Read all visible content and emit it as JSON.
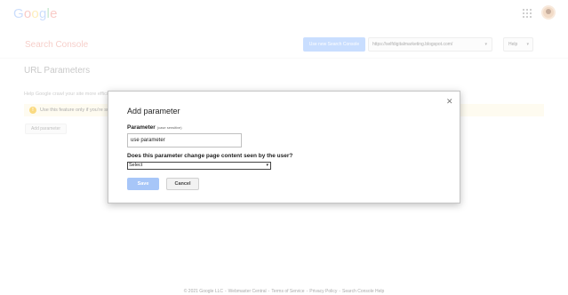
{
  "topbar": {
    "logo_letters": [
      {
        "ch": "G",
        "color": "#4285F4"
      },
      {
        "ch": "o",
        "color": "#EA4335"
      },
      {
        "ch": "o",
        "color": "#FBBC05"
      },
      {
        "ch": "g",
        "color": "#4285F4"
      },
      {
        "ch": "l",
        "color": "#34A853"
      },
      {
        "ch": "e",
        "color": "#EA4335"
      }
    ],
    "apps_icon": "apps-grid-icon",
    "avatar_icon": "user-avatar"
  },
  "header": {
    "product_title": "Search Console",
    "new_console_button": "Use new Search Console",
    "site_select_value": "https://selfdigitalmarketing.blogspot.com/",
    "help_label": "Help"
  },
  "page": {
    "title": "URL Parameters",
    "help_text": "Help Google crawl your site more efficiently",
    "warning_text": "Use this feature only if you're sure how parameters work",
    "add_parameter_button": "Add parameter"
  },
  "dialog": {
    "title": "Add parameter",
    "close_icon": "close-icon",
    "parameter_label": "Parameter",
    "parameter_hint": "(case sensitive)",
    "parameter_value": "use parameter",
    "question": "Does this parameter change page content seen by the user?",
    "select_value": "Select",
    "save_label": "Save",
    "cancel_label": "Cancel"
  },
  "footer": {
    "items": [
      "© 2021 Google LLC",
      "Webmaster Central",
      "Terms of Service",
      "Privacy Policy",
      "Search Console Help"
    ],
    "separator": "-"
  },
  "colors": {
    "accent_blue": "#4d90fe",
    "save_disabled": "#a7c6f8",
    "warning_bg": "#fdf6e0",
    "product_red": "#dd4b39"
  }
}
